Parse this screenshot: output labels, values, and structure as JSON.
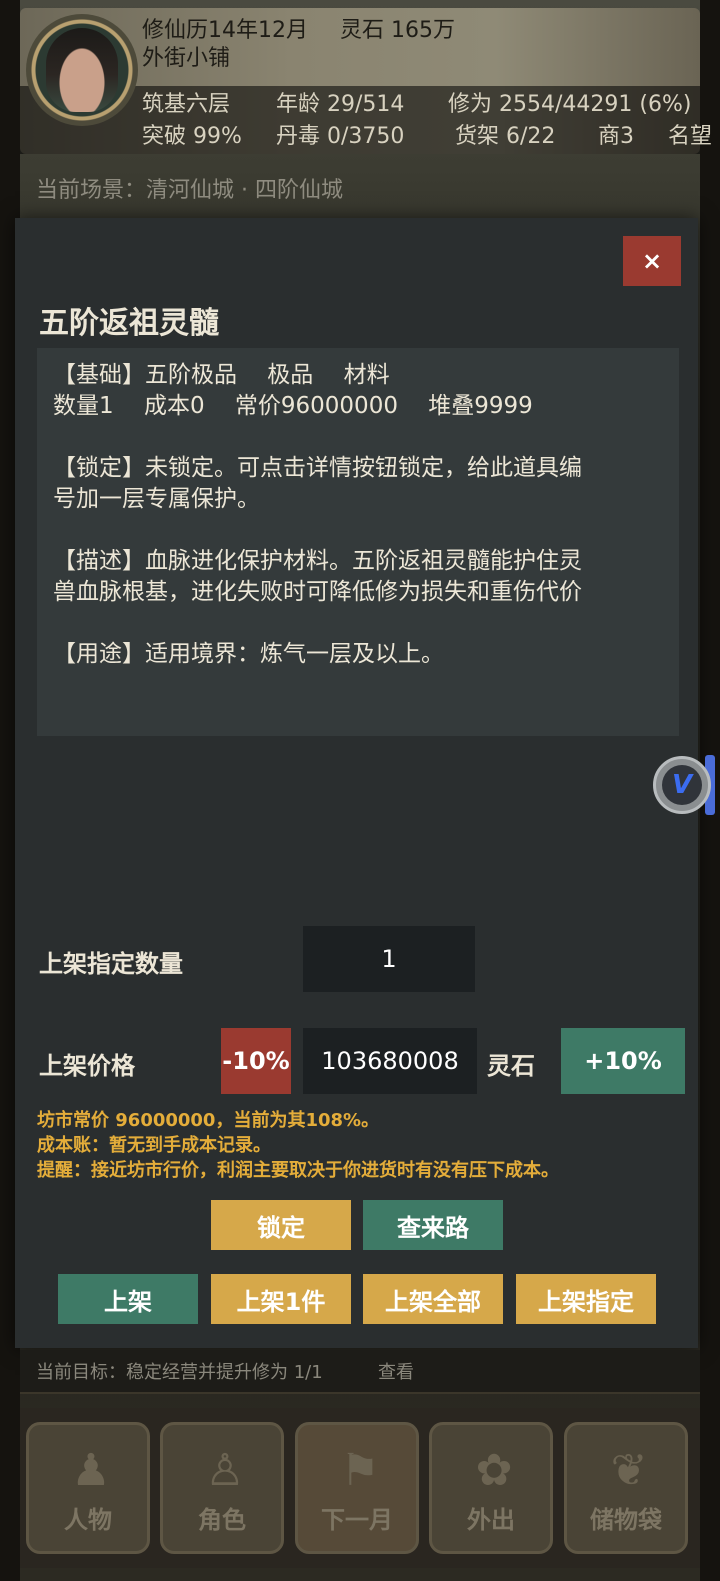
{
  "header": {
    "calendar": "修仙历14年12月",
    "spirit_stones": "灵石 165万",
    "shop_name": "外街小铺",
    "realm": "筑基六层",
    "age": "年龄 29/514",
    "cultivation": "修为 2554/44291 (6%)",
    "breakthrough": "突破 99%",
    "pill_poison": "丹毒 0/3750",
    "shelves": "货架 6/22",
    "merchant": "商3",
    "reputation": "名望"
  },
  "scene": "当前场景：清河仙城 · 四阶仙城",
  "modal": {
    "close_label": "×",
    "title": "五阶返祖灵髓",
    "description": {
      "line1": "【基础】五阶极品　 极品　 材料",
      "line2": "数量1　 成本0　 常价96000000　 堆叠9999",
      "line3": "【锁定】未锁定。可点击详情按钮锁定，给此道具编",
      "line4": "号加一层专属保护。",
      "line5": "【描述】血脉进化保护材料。五阶返祖灵髓能护住灵",
      "line6": "兽血脉根基，进化失败时可降低修为损失和重伤代价",
      "line7": "【用途】适用境界：炼气一层及以上。"
    },
    "quantity_label": "上架指定数量",
    "quantity_value": "1",
    "price_label": "上架价格",
    "minus_label": "-10%",
    "price_value": "103680008",
    "currency": "灵石",
    "plus_label": "+10%",
    "hint_market": "坊市常价 96000000，当前为其108%。",
    "hint_cost": "成本账：暂无到手成本记录。",
    "hint_reminder": "提醒：接近坊市行价，利润主要取决于你进货时有没有压下成本。",
    "lock_label": "锁定",
    "trace_label": "查来路",
    "list_label": "上架",
    "list_one_label": "上架1件",
    "list_all_label": "上架全部",
    "list_specified_label": "上架指定"
  },
  "goal": {
    "text": "当前目标：稳定经营并提升修为 1/1",
    "view_label": "查看"
  },
  "nav": {
    "items": [
      {
        "label": "人物",
        "icon": "person-icon"
      },
      {
        "label": "角色",
        "icon": "character-icon"
      },
      {
        "label": "下一月",
        "icon": "flag-icon"
      },
      {
        "label": "外出",
        "icon": "travel-icon"
      },
      {
        "label": "储物袋",
        "icon": "bag-icon"
      }
    ]
  },
  "colors": {
    "accent_red": "#9a3a30",
    "accent_green": "#3e7a66",
    "accent_gold": "#d6a84a",
    "hint_text": "#e4ad3a",
    "modal_bg": "#2a2e2f"
  }
}
